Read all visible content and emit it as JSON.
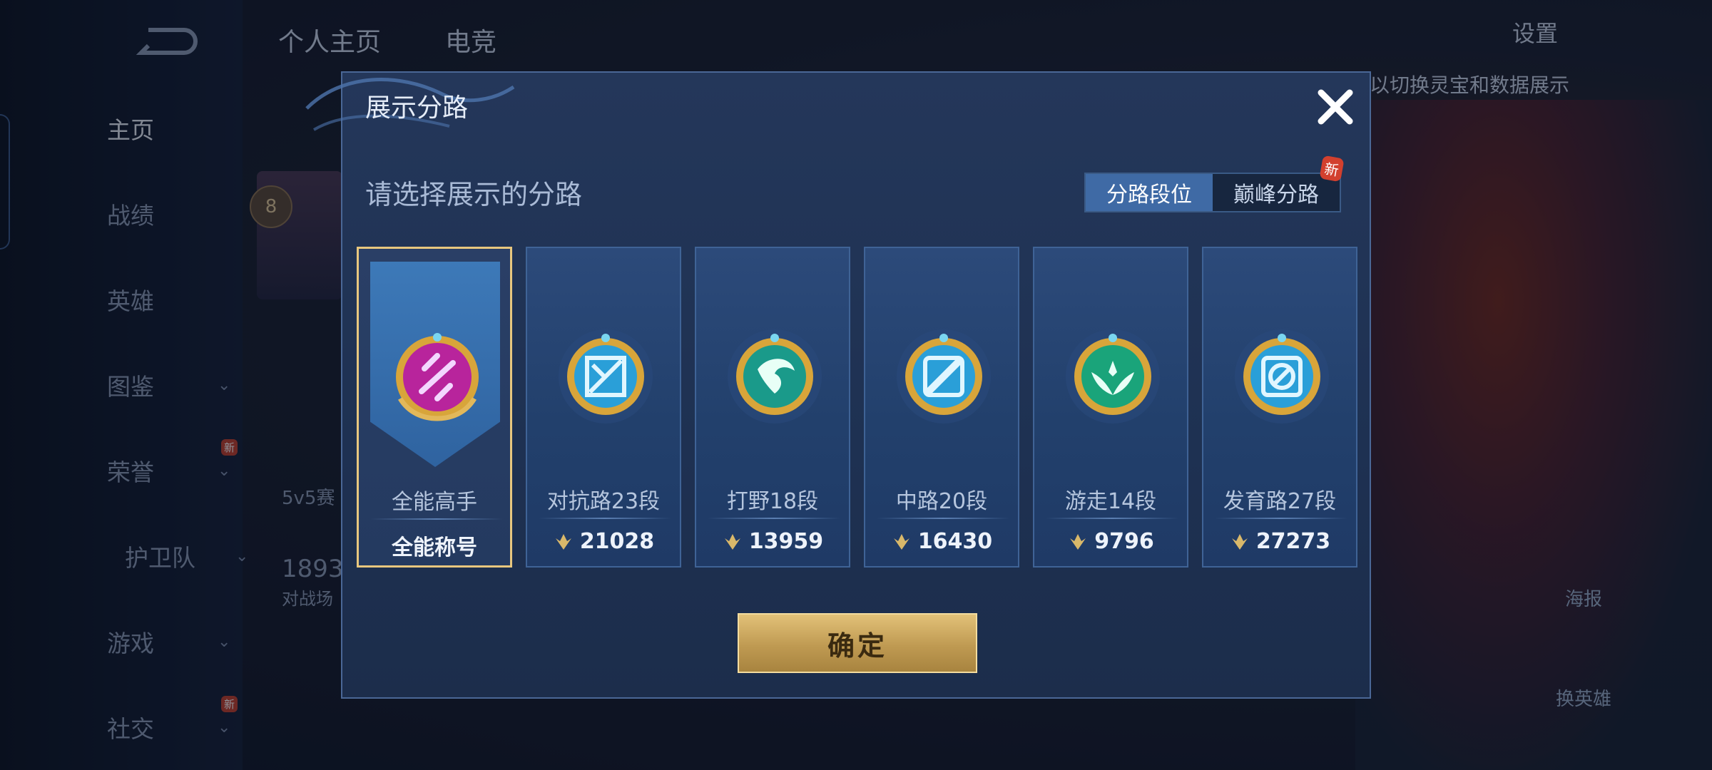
{
  "background": {
    "nav": {
      "items": [
        {
          "label": "主页",
          "active": true
        },
        {
          "label": "战绩"
        },
        {
          "label": "英雄"
        },
        {
          "label": "图鉴",
          "expandable": true
        },
        {
          "label": "荣誉",
          "expandable": true,
          "badge": "新"
        },
        {
          "label": "护卫队",
          "expandable": true
        },
        {
          "label": "游戏",
          "expandable": true
        },
        {
          "label": "社交",
          "expandable": true,
          "badge": "新"
        }
      ]
    },
    "top_tabs": [
      "个人主页",
      "电竞"
    ],
    "settings_label": "设置",
    "hint": "以切换灵宝和数据展示",
    "level": "8",
    "text_5v5": "5v5赛",
    "number": "1893",
    "text_battle": "对战场",
    "poster_label": "海报",
    "switch_hero_label": "换英雄"
  },
  "modal": {
    "title": "展示分路",
    "close_icon": "close-icon",
    "subtitle": "请选择展示的分路",
    "segment": {
      "options": [
        "分路段位",
        "巅峰分路"
      ],
      "active_index": 0,
      "new_badge": "新"
    },
    "cards": [
      {
        "label": "全能高手",
        "value": "全能称号",
        "icon": "allround-badge-icon",
        "color": "#b8249c",
        "selected": true
      },
      {
        "label": "对抗路23段",
        "value": "21028",
        "icon": "clash-lane-badge-icon",
        "color": "#2a9fd8"
      },
      {
        "label": "打野18段",
        "value": "13959",
        "icon": "jungle-badge-icon",
        "color": "#1a9a8a"
      },
      {
        "label": "中路20段",
        "value": "16430",
        "icon": "mid-lane-badge-icon",
        "color": "#2a9fd8"
      },
      {
        "label": "游走14段",
        "value": "9796",
        "icon": "roam-badge-icon",
        "color": "#1aa47a"
      },
      {
        "label": "发育路27段",
        "value": "27273",
        "icon": "farm-lane-badge-icon",
        "color": "#2a9fd8"
      }
    ],
    "confirm_label": "确定"
  }
}
